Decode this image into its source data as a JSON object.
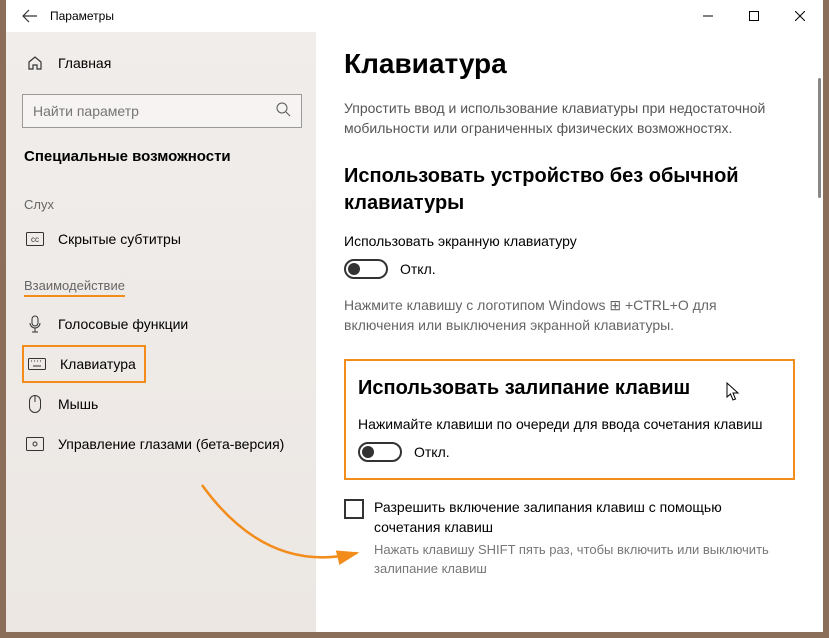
{
  "window": {
    "title": "Параметры"
  },
  "sidebar": {
    "home_label": "Главная",
    "search_placeholder": "Найти параметр",
    "section_title": "Специальные возможности",
    "groups": {
      "hearing": {
        "label": "Слух",
        "items": [
          {
            "label": "Скрытые субтитры"
          }
        ]
      },
      "interaction": {
        "label": "Взаимодействие",
        "items": [
          {
            "label": "Голосовые функции"
          },
          {
            "label": "Клавиатура"
          },
          {
            "label": "Мышь"
          },
          {
            "label": "Управление глазами (бета-версия)"
          }
        ]
      }
    }
  },
  "content": {
    "page_title": "Клавиатура",
    "desc": "Упростить ввод и использование клавиатуры при недостаточной мобильности или ограниченных физических возможностях.",
    "osk": {
      "heading": "Использовать устройство без обычной клавиатуры",
      "toggle_label": "Использовать экранную клавиатуру",
      "toggle_state": "Откл.",
      "hint": "Нажмите клавишу с логотипом Windows ⊞ +CTRL+O для включения или выключения экранной клавиатуры."
    },
    "sticky": {
      "heading": "Использовать залипание клавиш",
      "toggle_label": "Нажимайте клавиши по очереди для ввода сочетания клавиш",
      "toggle_state": "Откл.",
      "checkbox_label": "Разрешить включение залипания клавиш с помощью сочетания клавиш",
      "checkbox_hint": "Нажать клавишу SHIFT пять раз, чтобы включить или выключить залипание клавиш"
    }
  }
}
